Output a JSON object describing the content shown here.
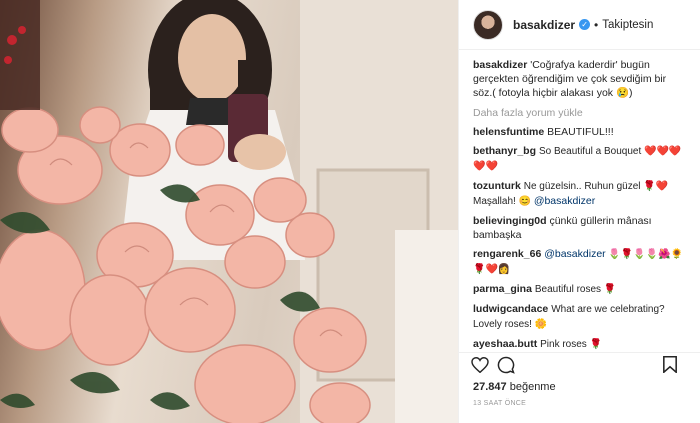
{
  "post": {
    "username": "basakdizer",
    "follow_status": "Takiptesin",
    "separator": "•",
    "verified_mark": "✓"
  },
  "caption": {
    "username": "basakdizer",
    "text": "'Coğrafya kaderdir' bugün gerçekten öğrendiğim ve çok sevdiğim bir söz.( fotoyla hiçbir alakası yok 😢)"
  },
  "load_more": "Daha fazla yorum yükle",
  "comments": [
    {
      "user": "helensfuntime",
      "text": "BEAUTIFUL!!!"
    },
    {
      "user": "bethanyr_bg",
      "text": "So Beautiful a Bouquet ❤️❤️❤️❤️❤️"
    },
    {
      "user": "tozunturk",
      "text": "Ne güzelsin.. Ruhun güzel 🌹❤️ Maşallah! 😊 ",
      "mention": "@basakdizer"
    },
    {
      "user": "believinging0d",
      "text": "çünkü güllerin mânası bambaşka"
    },
    {
      "user": "rengarenk_66",
      "mention": "@basakdizer",
      "text": " 🌷🌹🌷🌷🌺🌻🌹❤️👩"
    },
    {
      "user": "parma_gina",
      "text": "Beautiful roses 🌹"
    },
    {
      "user": "ludwigcandace",
      "text": "What are we celebrating? Lovely roses! 🌼"
    },
    {
      "user": "ayeshaa.butt",
      "text": "Pink roses 🌹"
    }
  ],
  "likes": {
    "count": "27.847",
    "label": "beğenme"
  },
  "timestamp": "13 SAAT ÖNCE",
  "icons": {
    "like": "heart-icon",
    "comment": "comment-icon",
    "bookmark": "bookmark-icon"
  },
  "colors": {
    "verified": "#3897f0",
    "rose": "#f2b3a6",
    "leaf": "#2f4a2c"
  }
}
